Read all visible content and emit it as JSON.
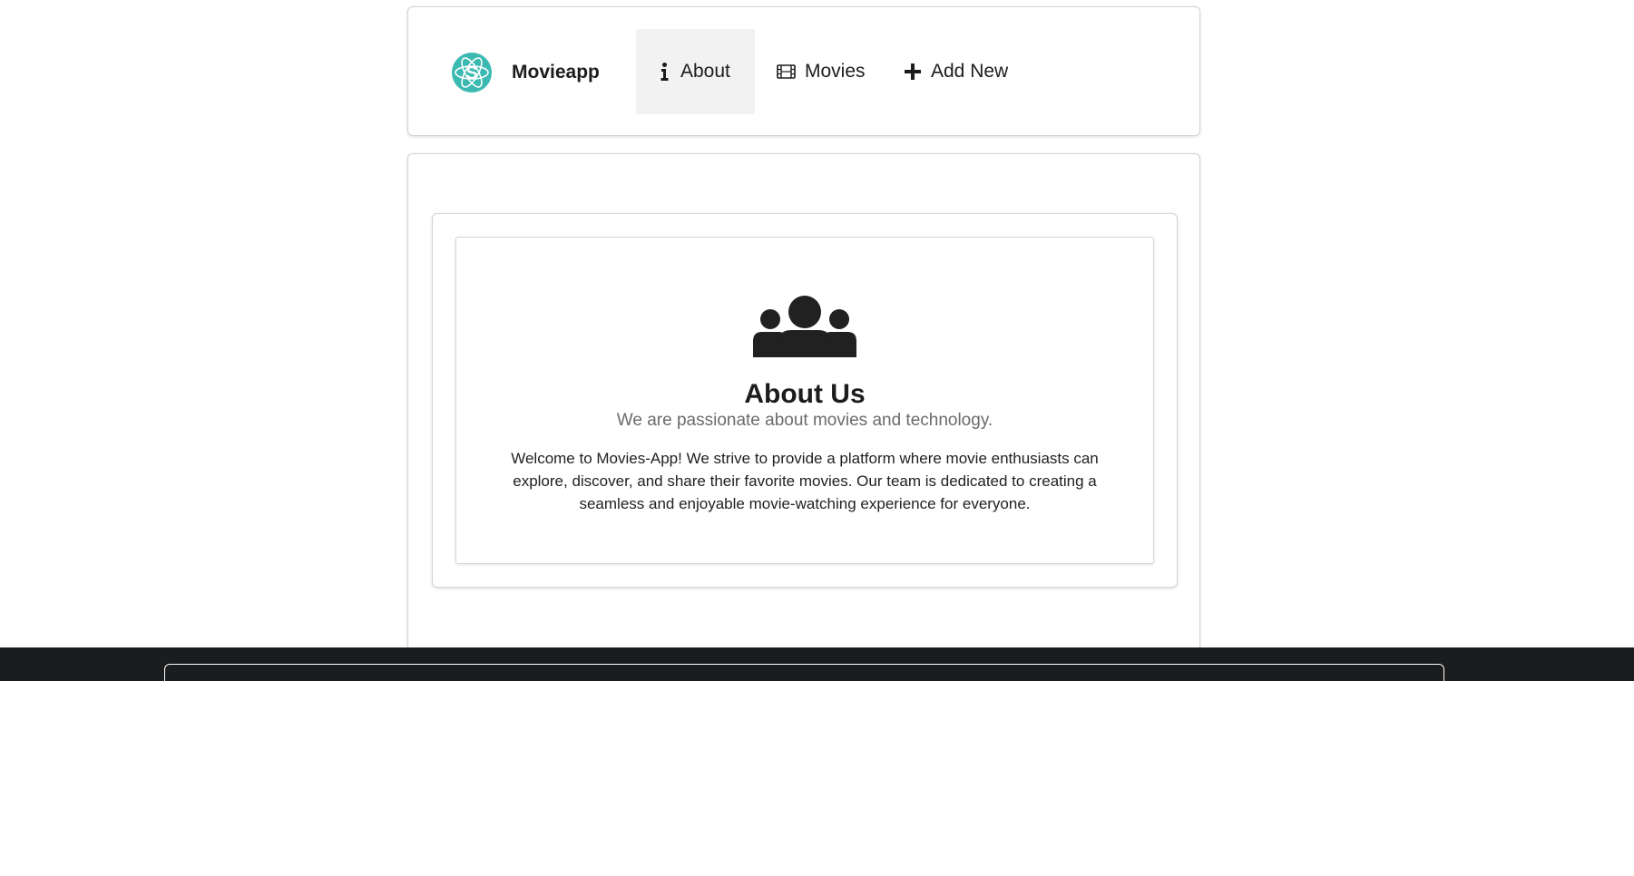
{
  "brand": {
    "name": "Movieapp",
    "logo_icon": "atom-s-logo-icon",
    "logo_color": "#3cbab2"
  },
  "nav": {
    "items": [
      {
        "label": "About",
        "icon": "info-icon",
        "active": true
      },
      {
        "label": "Movies",
        "icon": "film-icon",
        "active": false
      },
      {
        "label": "Add New",
        "icon": "plus-icon",
        "active": false
      }
    ]
  },
  "about": {
    "icon": "users-icon",
    "title": "About Us",
    "subtitle": "We are passionate about movies and technology.",
    "body": "Welcome to Movies-App! We strive to provide a platform where movie enthusiasts can explore, discover, and share their favorite movies. Our team is dedicated to creating a seamless and enjoyable movie-watching experience for everyone."
  },
  "colors": {
    "footer_bg": "#1b1c1d",
    "active_nav_bg": "#f2f2f2",
    "text": "#1b1c1d",
    "muted_text": "#6b6b6b"
  }
}
